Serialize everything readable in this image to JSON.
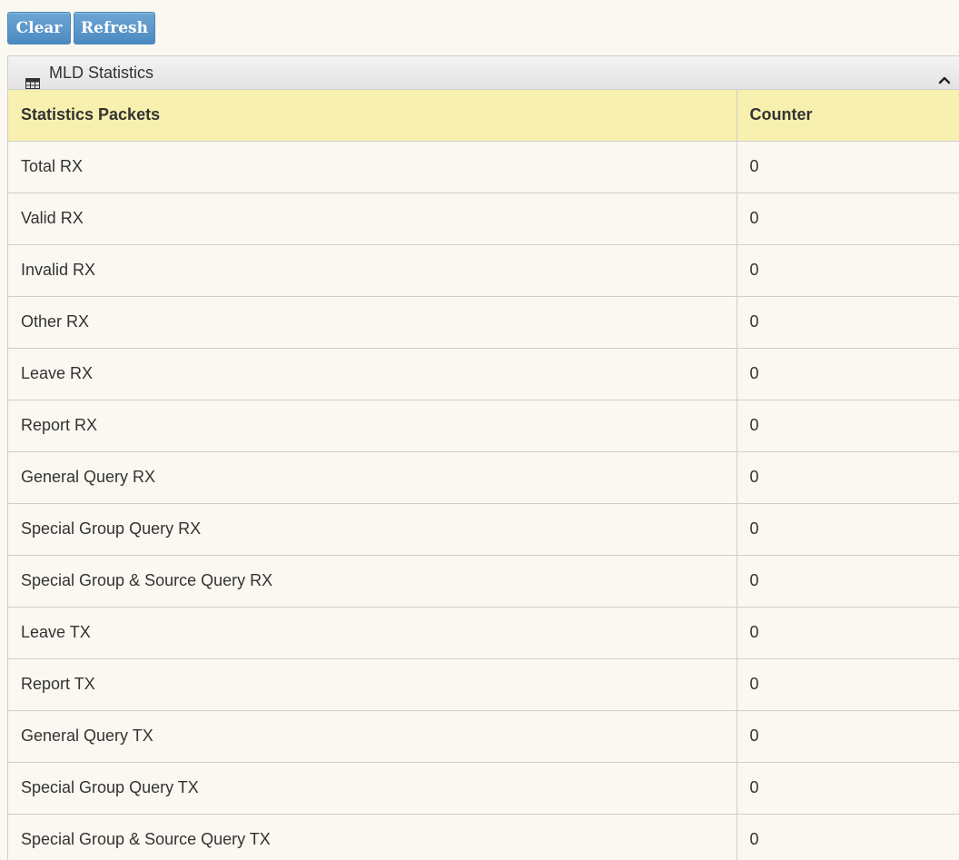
{
  "toolbar": {
    "clear_label": "Clear",
    "refresh_label": "Refresh"
  },
  "panel": {
    "title": "MLD Statistics",
    "header_icon": "table-icon",
    "collapse_icon": "chevron-up-icon"
  },
  "table": {
    "headers": [
      "Statistics Packets",
      "Counter"
    ],
    "rows": [
      {
        "packet": "Total RX",
        "counter": "0"
      },
      {
        "packet": "Valid RX",
        "counter": "0"
      },
      {
        "packet": "Invalid RX",
        "counter": "0"
      },
      {
        "packet": "Other RX",
        "counter": "0"
      },
      {
        "packet": "Leave RX",
        "counter": "0"
      },
      {
        "packet": "Report RX",
        "counter": "0"
      },
      {
        "packet": "General Query RX",
        "counter": "0"
      },
      {
        "packet": "Special Group Query RX",
        "counter": "0"
      },
      {
        "packet": "Special Group & Source Query RX",
        "counter": "0"
      },
      {
        "packet": "Leave TX",
        "counter": "0"
      },
      {
        "packet": "Report TX",
        "counter": "0"
      },
      {
        "packet": "General Query TX",
        "counter": "0"
      },
      {
        "packet": "Special Group Query TX",
        "counter": "0"
      },
      {
        "packet": "Special Group & Source Query TX",
        "counter": "0"
      }
    ]
  },
  "colors": {
    "button": "#5b97c9",
    "table_header": "#f7f0ae",
    "background": "#faf8f1"
  }
}
